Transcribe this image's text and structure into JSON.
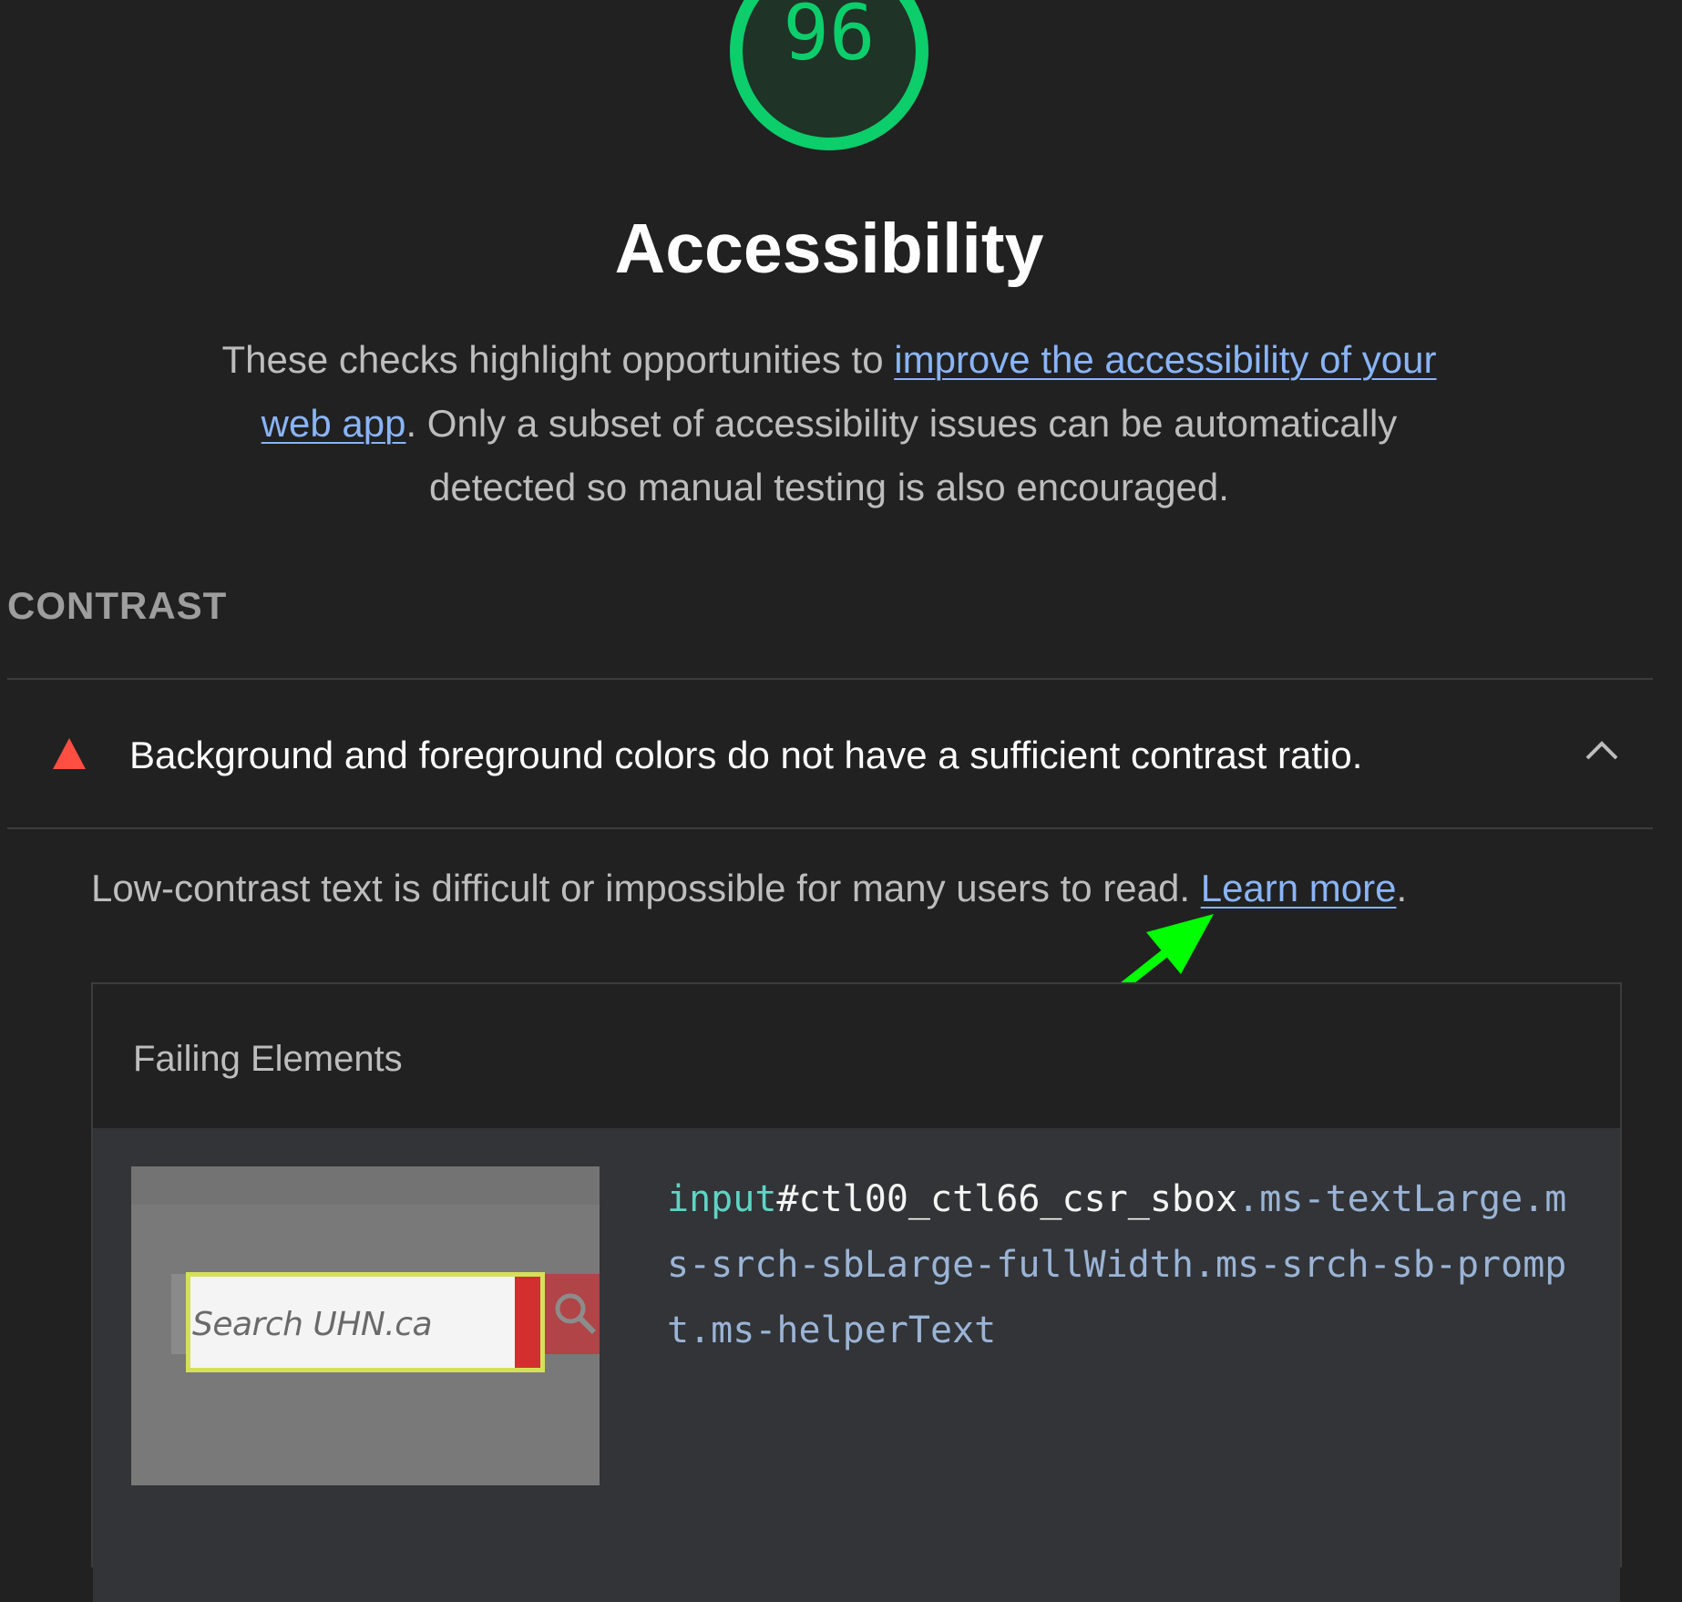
{
  "score": {
    "value": "96",
    "color": "#0cce6b"
  },
  "category": {
    "title": "Accessibility",
    "description_before": "These checks highlight opportunities to ",
    "description_link": "improve the accessibility of your web app",
    "description_after": ". Only a subset of accessibility issues can be automatically detected so manual testing is also encouraged."
  },
  "group": {
    "title": "CONTRAST"
  },
  "audit": {
    "title": "Background and foreground colors do not have a sufficient contrast ratio.",
    "status_icon": "fail-triangle-icon",
    "status_color": "#ff4e42",
    "expand_icon": "chevron-up-icon",
    "description": "Low-contrast text is difficult or impossible for many users to read. ",
    "learn_more": "Learn more",
    "description_end": ".",
    "link_color": "#8ab4f8",
    "annotation_arrow_color": "#00ff00"
  },
  "details": {
    "heading": "Failing Elements",
    "items": [
      {
        "thumbnail_text": "Search UHN.ca",
        "node_tag": "input",
        "node_id": "#ctl00_ctl66_csr_sbox",
        "node_classes": ".ms-textLarge.ms-srch-sbLarge-fullWidth.ms-srch-sb-prompt.ms-helperText"
      }
    ]
  }
}
